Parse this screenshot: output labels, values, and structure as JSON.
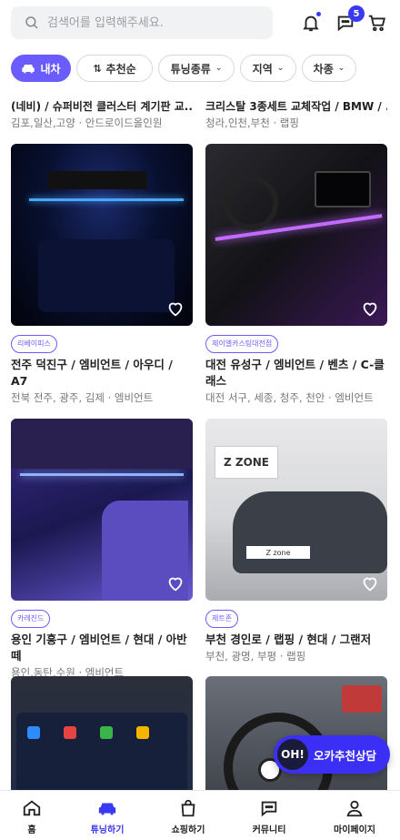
{
  "search": {
    "placeholder": "검색어를 입력해주세요."
  },
  "header": {
    "chat_badge": "5"
  },
  "filters": {
    "car": "내차",
    "sort": "추천순",
    "tuning": "튜닝종류",
    "region": "지역",
    "model": "차종"
  },
  "partial_cards": [
    {
      "title": "(네비) / 슈퍼비전 클러스터 계기판 교...",
      "sub": "김포,일산,고양 · 안드로이드올인원"
    },
    {
      "title": "크리스탈 3종세트 교체작업 / BMW / ...",
      "sub": "청라,인천,부천 · 랩핑"
    }
  ],
  "cards": [
    {
      "tag": "리베이피스",
      "title": "전주 덕진구 / 엠비언트 / 아우디 / A7",
      "sub": "전북 전주, 광주, 김제 · 엠비언트"
    },
    {
      "tag": "제이엘카스팅대전점",
      "title": "대전 유성구 / 엠비언트 / 벤츠 / C-클래스",
      "sub": "대전 서구, 세종, 청주, 천안 · 엠비언트"
    },
    {
      "tag": "카레진드",
      "title": "용인 기흥구 / 엠비언트 / 현대 / 아반떼",
      "sub": "용인,동탄,수원 · 엠비언트"
    },
    {
      "tag": "제트존",
      "title": "부천 경인로 / 랩핑 / 현대 / 그랜저",
      "sub": "부천, 광명, 부평 · 랩핑"
    }
  ],
  "consult": {
    "badge": "OH!",
    "label": "오카추천상담"
  },
  "nav": {
    "home": "홈",
    "tuning": "튜닝하기",
    "shopping": "쇼핑하기",
    "community": "커뮤니티",
    "mypage": "마이페이지"
  },
  "colors": {
    "accent": "#3b38f2",
    "chip_active": "#6b5cff"
  }
}
